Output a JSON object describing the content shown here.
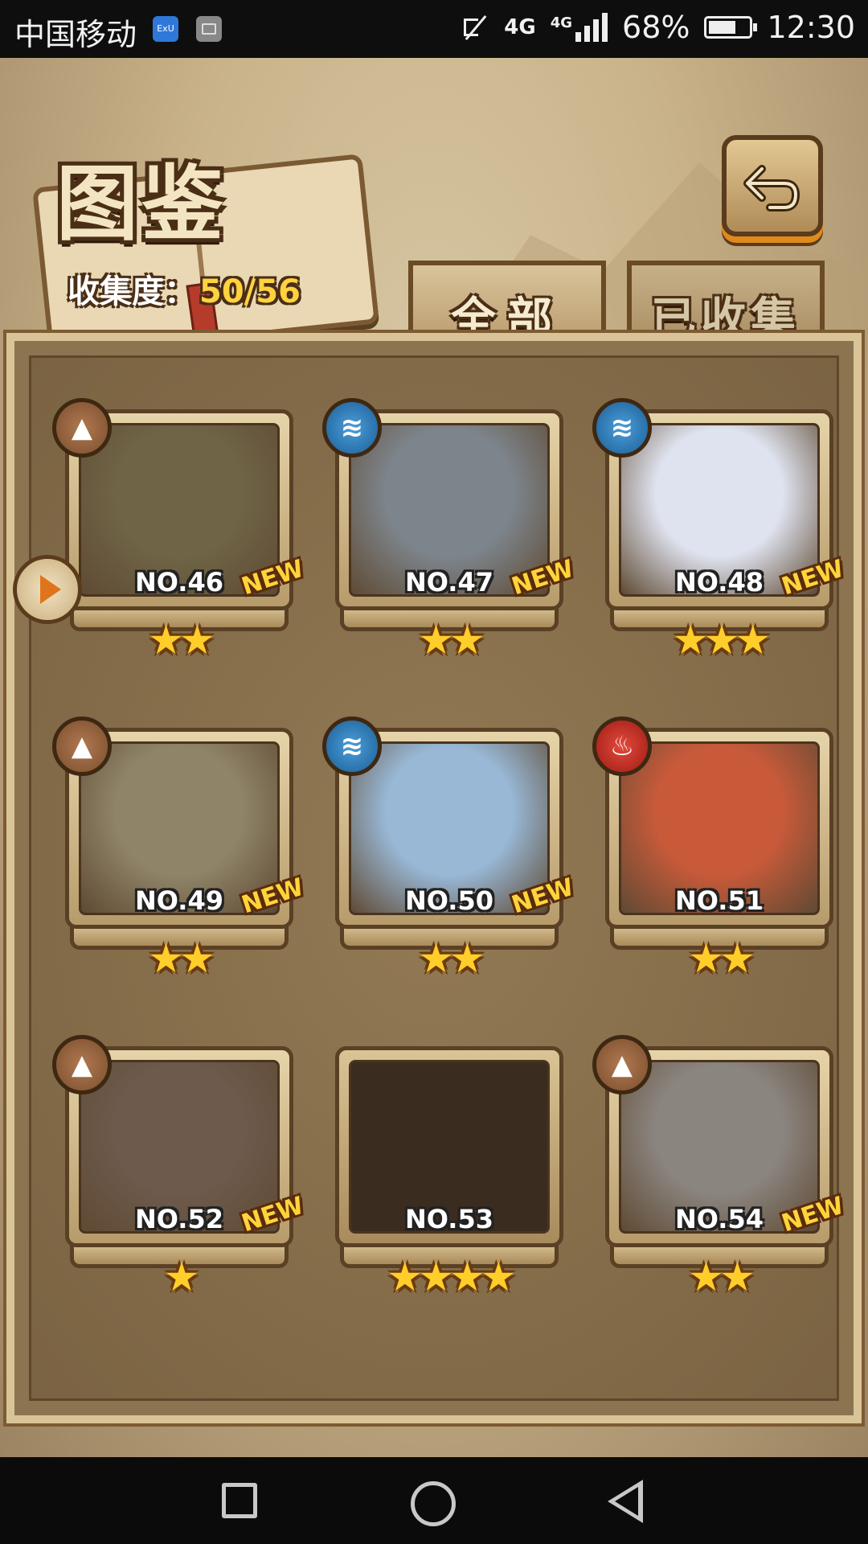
{
  "status_bar": {
    "carrier": "中国移动",
    "app_icon_1": "ExU",
    "network_1": "4G",
    "network_2": "4G",
    "battery": "68%",
    "battery_level": 0.68,
    "time": "12:30"
  },
  "header": {
    "title": "图鉴",
    "collection_label": "收集度：",
    "collection_value": "50/56"
  },
  "tabs": [
    {
      "label": "全部",
      "active": true
    },
    {
      "label": "已收集",
      "active": false
    }
  ],
  "cards": [
    {
      "number": "NO.46",
      "stars": "★★",
      "new": "NEW",
      "element": "earth",
      "element_icon": "▲",
      "color": "#6f6446"
    },
    {
      "number": "NO.47",
      "stars": "★★",
      "new": "NEW",
      "element": "water",
      "element_icon": "≋",
      "color": "#7d858c"
    },
    {
      "number": "NO.48",
      "stars": "★★★",
      "new": "NEW",
      "element": "water",
      "element_icon": "≋",
      "color": "#dfe3ef"
    },
    {
      "number": "NO.49",
      "stars": "★★",
      "new": "NEW",
      "element": "earth",
      "element_icon": "▲",
      "color": "#8f8468"
    },
    {
      "number": "NO.50",
      "stars": "★★",
      "new": "NEW",
      "element": "water",
      "element_icon": "≋",
      "color": "#98b8d6"
    },
    {
      "number": "NO.51",
      "stars": "★★",
      "new": "",
      "element": "fire",
      "element_icon": "♨",
      "color": "#c85a3a"
    },
    {
      "number": "NO.52",
      "stars": "★",
      "new": "NEW",
      "element": "earth",
      "element_icon": "▲",
      "color": "#6d5a4c"
    },
    {
      "number": "NO.53",
      "stars": "★★★★",
      "new": "",
      "element": "",
      "element_icon": "",
      "color": "#3a2c1f"
    },
    {
      "number": "NO.54",
      "stars": "★★",
      "new": "NEW",
      "element": "earth",
      "element_icon": "▲",
      "color": "#8b8580"
    }
  ]
}
